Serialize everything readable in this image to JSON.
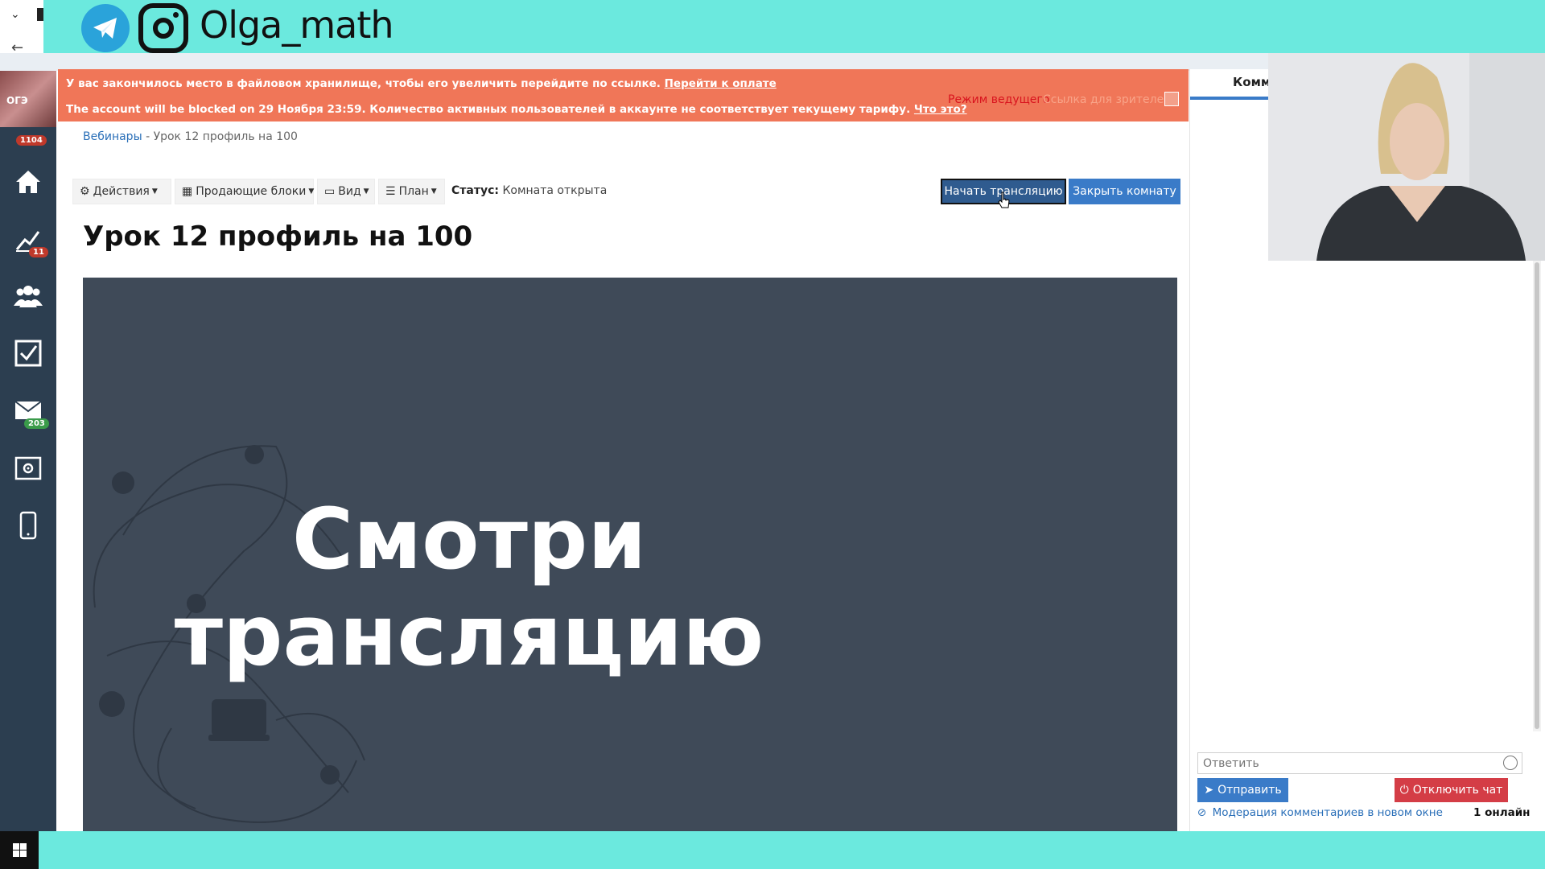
{
  "banner": {
    "brand": "Olga_math"
  },
  "sidebar": {
    "avatar_text": "ОГЭ",
    "badge_top": "1104",
    "badge_stats": "11",
    "badge_mail": "203"
  },
  "notice": {
    "line1_text": "У вас закончилось место в файловом хранилище, чтобы его увеличить перейдите по ссылке.",
    "line1_link": "Перейти к оплате",
    "line2_text": "The account will be blocked on 29 Ноября 23:59. Количество активных пользователей в аккаунте не соответствует текущему тарифу.",
    "line2_link": "Что это?",
    "presenter_mode": "Режим ведущего",
    "viewer_link": "Ссылка для зрителей"
  },
  "breadcrumb": {
    "root": "Вебинары",
    "separator": " - ",
    "current": "Урок 12 профиль на 100"
  },
  "toolbar": {
    "actions": "Действия",
    "selling_blocks": "Продающие блоки",
    "view": "Вид",
    "plan": "План",
    "status_label": "Статус:",
    "status_value": "Комната открыта",
    "start_broadcast": "Начать трансляцию",
    "close_room": "Закрыть комнату"
  },
  "page": {
    "title": "Урок 12 профиль на 100"
  },
  "video": {
    "line1": "Смотри",
    "line2": "трансляцию"
  },
  "right_panel": {
    "tab_comments": "Комме"
  },
  "chat": {
    "reply_placeholder": "Ответить",
    "send": "Отправить",
    "disable_chat": "Отключить чат",
    "moderation": "Модерация комментариев в новом окне",
    "online": "1 онлайн"
  },
  "colors": {
    "accent_cyan": "#6be9de",
    "notice_orange": "#f07658",
    "sidebar_dark": "#2c3e50",
    "primary_blue": "#3a7bc8",
    "danger_red": "#d43d46"
  }
}
